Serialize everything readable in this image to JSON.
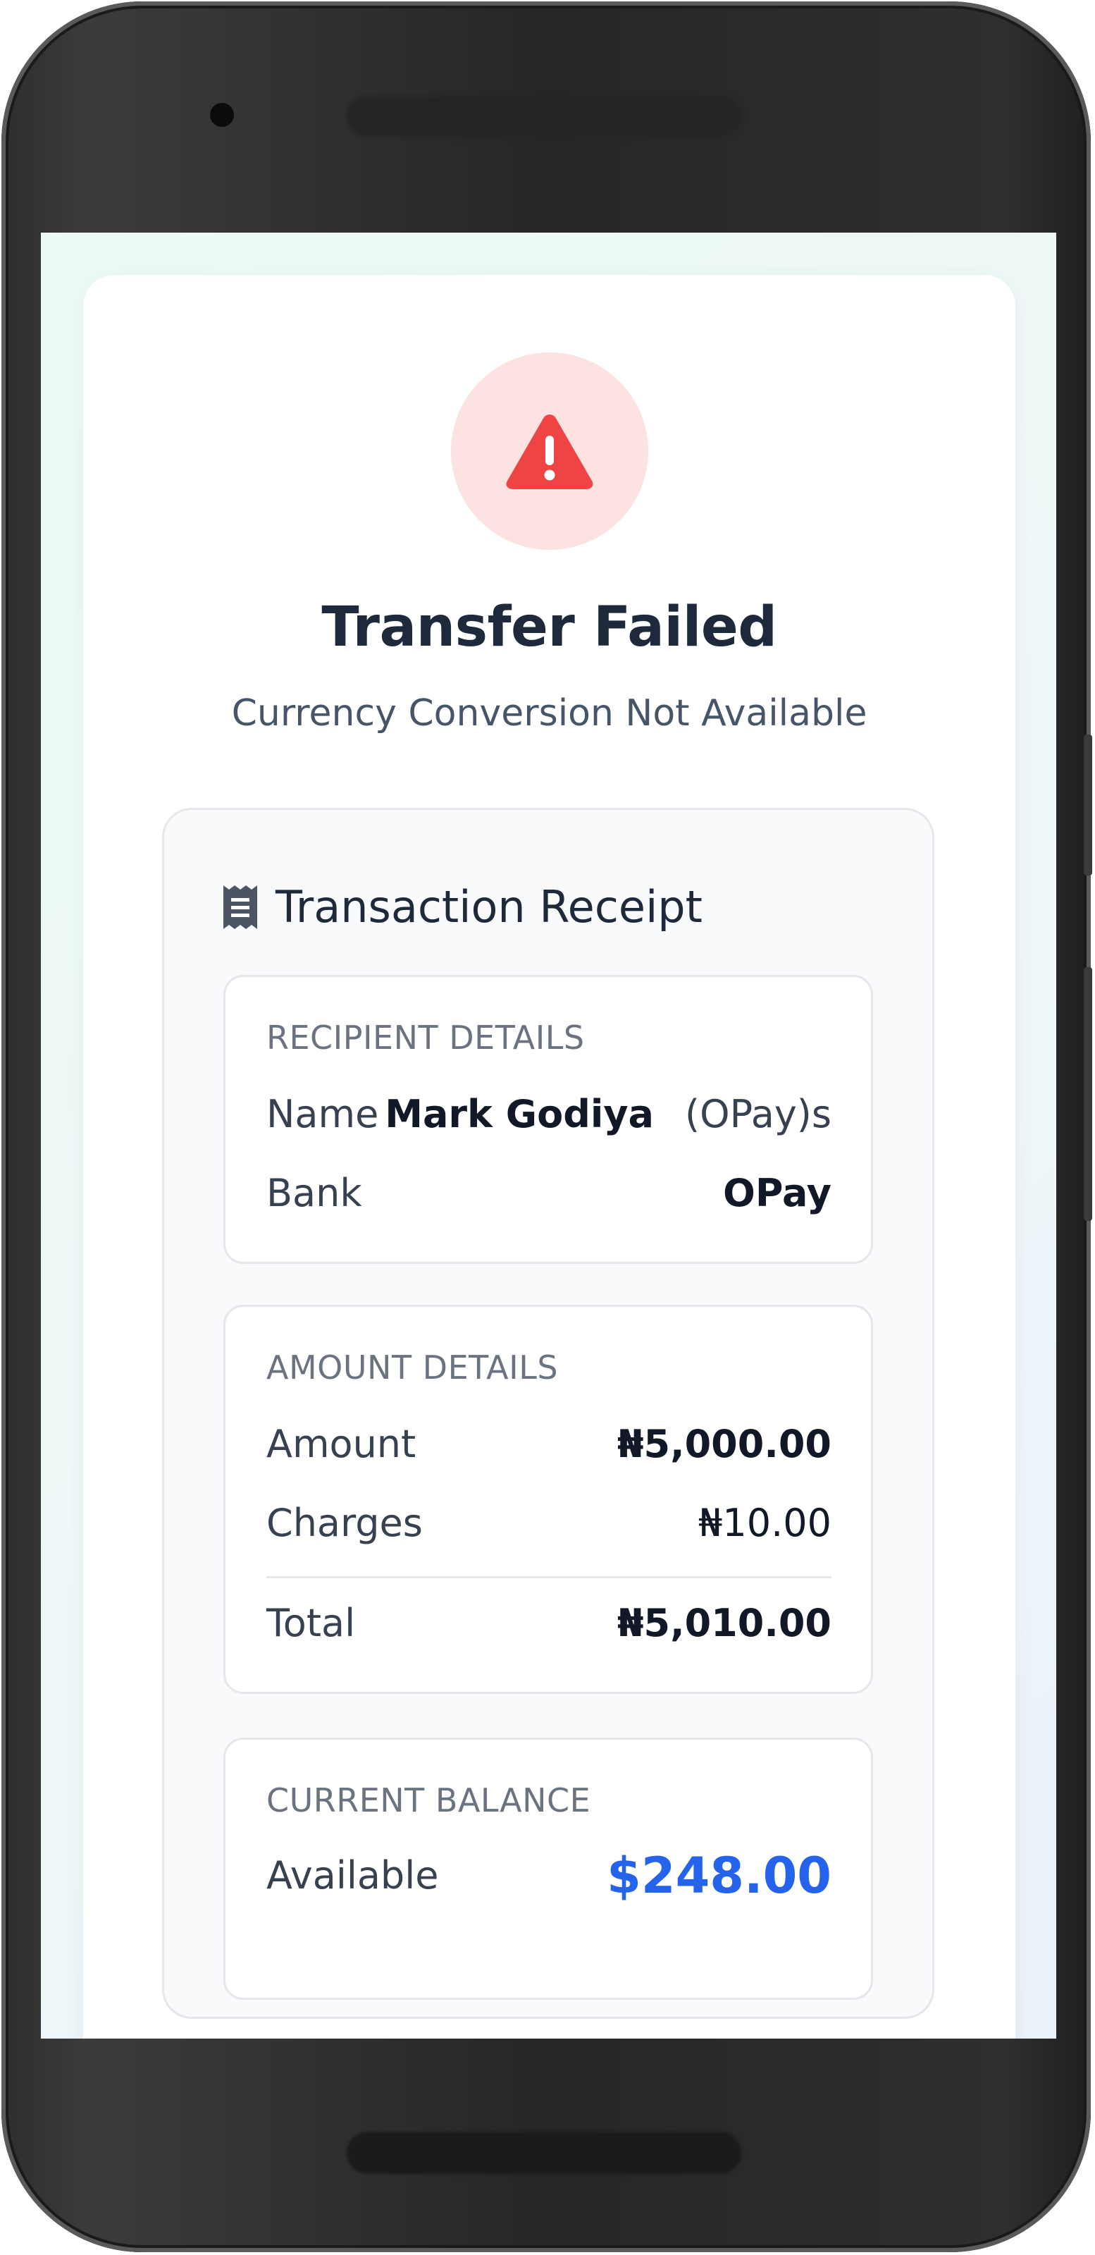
{
  "header": {
    "title": "Transfer Failed",
    "subtitle": "Currency Conversion Not Available"
  },
  "receipt": {
    "title": "Transaction Receipt",
    "recipient": {
      "section_label": "RECIPIENT DETAILS",
      "name_label": "Name",
      "name_value": "Mark Godiya",
      "name_suffix": "(OPay)s",
      "bank_label": "Bank",
      "bank_value": "OPay"
    },
    "amount": {
      "section_label": "AMOUNT DETAILS",
      "amount_label": "Amount",
      "amount_value": "₦5,000.00",
      "charges_label": "Charges",
      "charges_value": "₦10.00",
      "total_label": "Total",
      "total_value": "₦5,010.00"
    },
    "balance": {
      "section_label": "CURRENT BALANCE",
      "available_label": "Available",
      "available_value": "$248.00"
    }
  },
  "icons": {
    "status": "warning-triangle-icon",
    "receipt": "receipt-icon"
  },
  "colors": {
    "error_red": "#ef4444",
    "error_bg": "#fde2e2",
    "balance_blue": "#2563eb",
    "title": "#1e293b"
  }
}
